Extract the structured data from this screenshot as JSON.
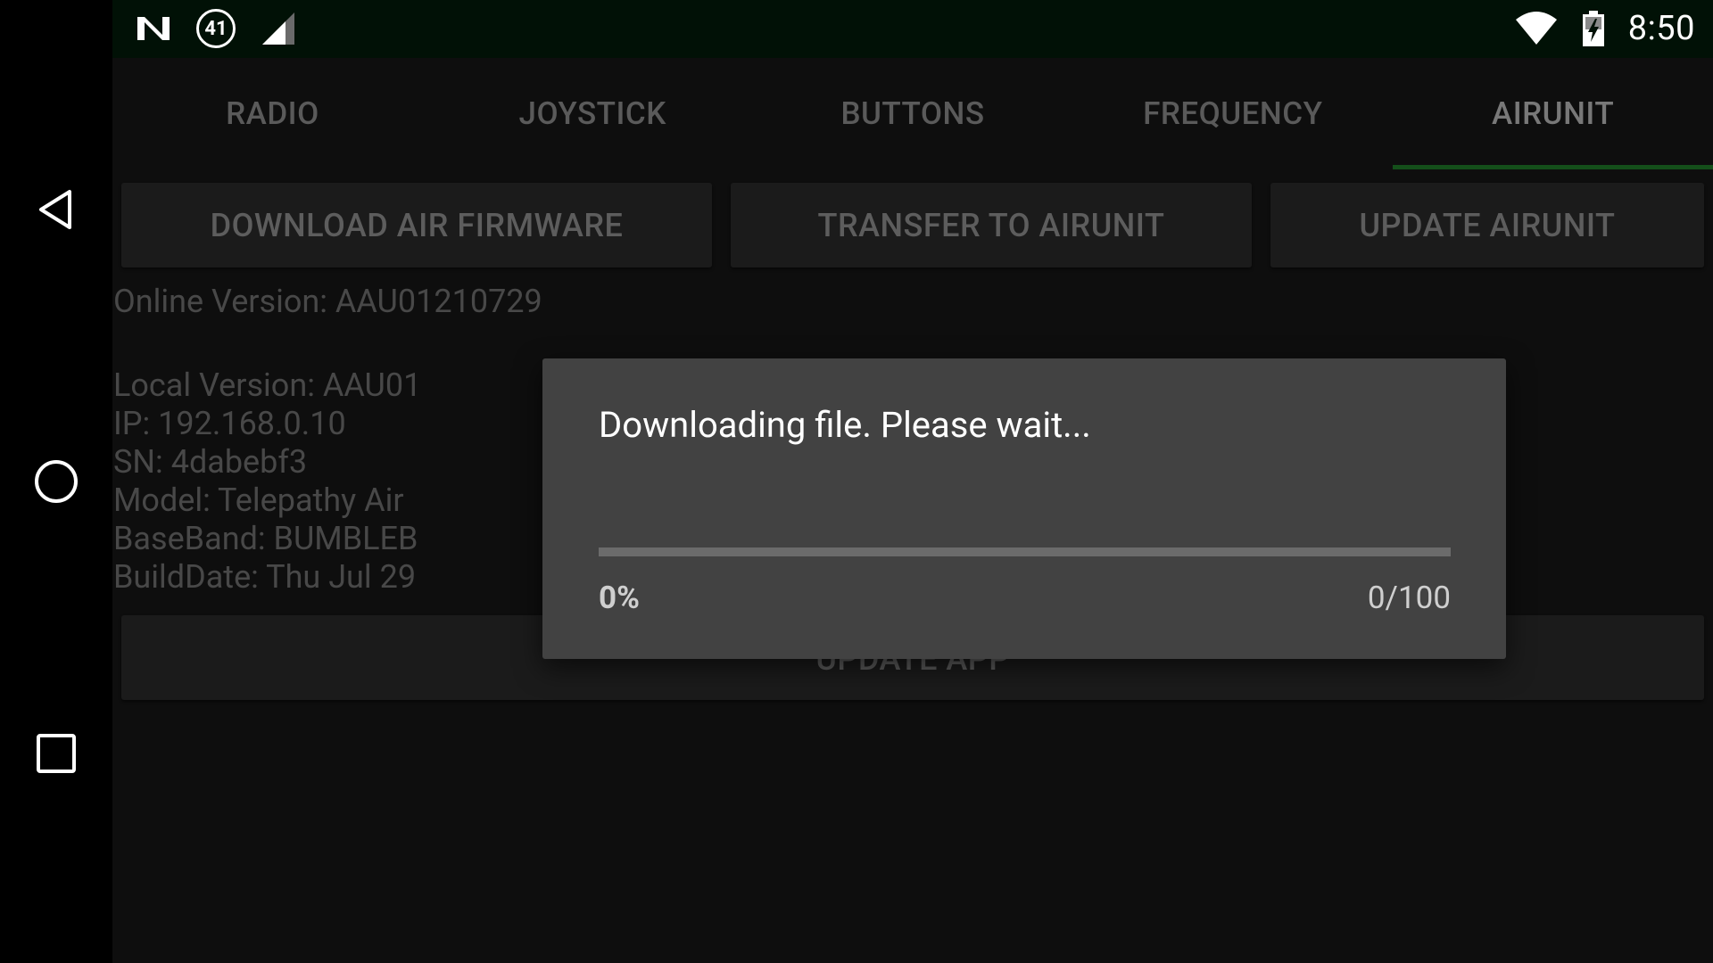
{
  "status_bar": {
    "time": "8:50",
    "notification_badge": "41",
    "icons": [
      "n-logo-icon",
      "notification-count-icon",
      "cell-signal-icon",
      "wifi-icon",
      "battery-charging-icon"
    ]
  },
  "tabs": [
    {
      "label": "RADIO",
      "active": false
    },
    {
      "label": "JOYSTICK",
      "active": false
    },
    {
      "label": "BUTTONS",
      "active": false
    },
    {
      "label": "FREQUENCY",
      "active": false
    },
    {
      "label": "AIRUNIT",
      "active": true
    }
  ],
  "actions": {
    "download_label": "DOWNLOAD AIR FIRMWARE",
    "transfer_label": "TRANSFER TO AIRUNIT",
    "update_label": "UPDATE AIRUNIT",
    "update_app_label": "UPDATE APP"
  },
  "info": {
    "online_version": "Online Version: AAU01210729",
    "local_version": "Local Version: AAU01",
    "ip": "IP: 192.168.0.10",
    "sn": "SN: 4dabebf3",
    "model": "Model: Telepathy Air",
    "baseband": "BaseBand: BUMBLEB",
    "build_date": "BuildDate: Thu Jul 29"
  },
  "dialog": {
    "message": "Downloading file. Please wait...",
    "progress": 0,
    "percent_text": "0%",
    "count_text": "0/100"
  },
  "colors": {
    "accent": "#1f7a28",
    "statusbar_bg": "#011106",
    "app_bg": "#161616",
    "dialog_bg": "#424242"
  }
}
